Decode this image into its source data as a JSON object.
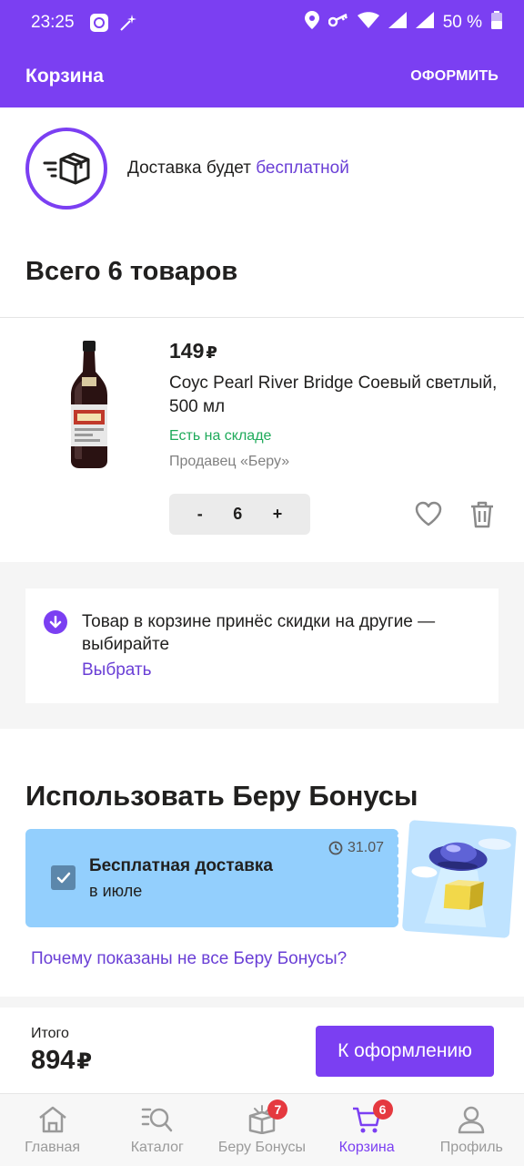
{
  "statusbar": {
    "time": "23:25",
    "battery": "50 %"
  },
  "header": {
    "title": "Корзина",
    "action": "ОФОРМИТЬ"
  },
  "delivery": {
    "text": "Доставка будет ",
    "accent": "бесплатной"
  },
  "cart": {
    "summary": "Всего 6 товаров"
  },
  "product": {
    "price": "149",
    "currency": "₽",
    "name": "Соус Pearl River Bridge Соевый светлый, 500 мл",
    "stock": "Есть на складе",
    "seller": "Продавец «Беру»",
    "quantity": "6",
    "minus": "-",
    "plus": "+"
  },
  "promo": {
    "message": "Товар в корзине принёс скидки на другие — выбирайте",
    "link": "Выбрать"
  },
  "bonuses": {
    "title": "Использовать Беру Бонусы",
    "card_title": "Бесплатная доставка",
    "card_subtitle": "в июле",
    "date": "31.07",
    "why_link": "Почему показаны не все Беру Бонусы?"
  },
  "checkout": {
    "label": "Итого",
    "total": "894",
    "currency": "₽",
    "button": "К оформлению"
  },
  "nav": {
    "items": [
      {
        "label": "Главная",
        "icon": "home-icon"
      },
      {
        "label": "Каталог",
        "icon": "catalog-search-icon"
      },
      {
        "label": "Беру Бонусы",
        "icon": "gift-box-icon",
        "badge": "7"
      },
      {
        "label": "Корзина",
        "icon": "cart-icon",
        "badge": "6"
      },
      {
        "label": "Профиль",
        "icon": "profile-icon"
      }
    ]
  },
  "colors": {
    "brand": "#7b3ff2",
    "link": "#6a3fd6",
    "stock": "#1eaa5a",
    "bonus_card": "#93cffd",
    "badge": "#e5393f"
  }
}
